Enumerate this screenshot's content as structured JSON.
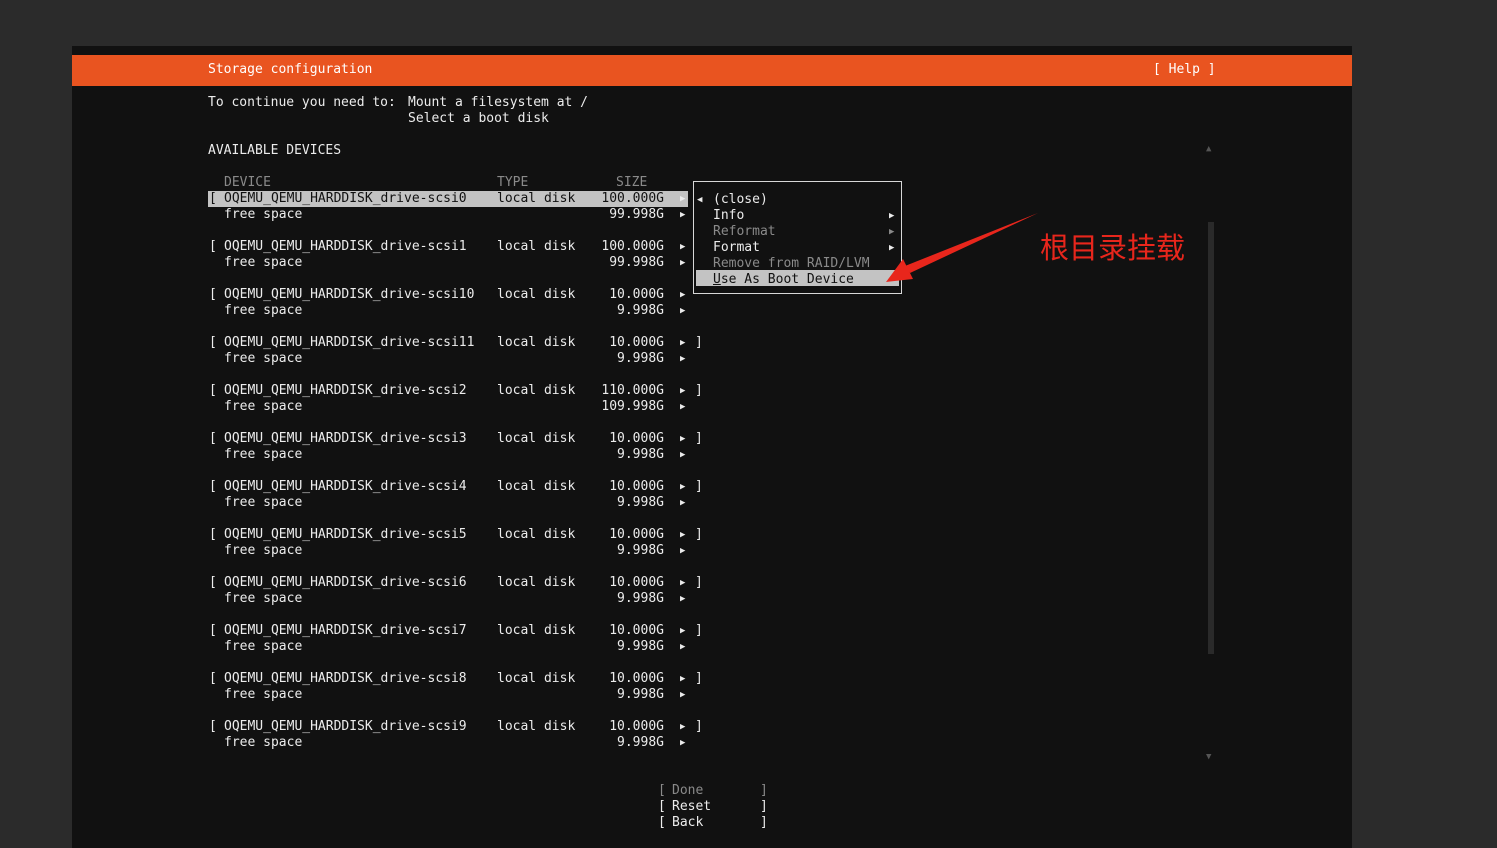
{
  "header": {
    "title": "Storage configuration",
    "help": "[ Help ]"
  },
  "intro": {
    "prefix": "To continue you need to:",
    "line1": "Mount a filesystem at /",
    "line2": "Select a boot disk"
  },
  "section_title": "AVAILABLE DEVICES",
  "columns": {
    "device": "DEVICE",
    "type": "TYPE",
    "size": "SIZE"
  },
  "devices": [
    {
      "name": "OQEMU_QEMU_HARDDISK_drive-scsi0",
      "type": "local disk",
      "size": "100.000G",
      "free_label": "free space",
      "free_size": "99.998G"
    },
    {
      "name": "OQEMU_QEMU_HARDDISK_drive-scsi1",
      "type": "local disk",
      "size": "100.000G",
      "free_label": "free space",
      "free_size": "99.998G"
    },
    {
      "name": "OQEMU_QEMU_HARDDISK_drive-scsi10",
      "type": "local disk",
      "size": "10.000G",
      "free_label": "free space",
      "free_size": "9.998G"
    },
    {
      "name": "OQEMU_QEMU_HARDDISK_drive-scsi11",
      "type": "local disk",
      "size": "10.000G",
      "free_label": "free space",
      "free_size": "9.998G"
    },
    {
      "name": "OQEMU_QEMU_HARDDISK_drive-scsi2",
      "type": "local disk",
      "size": "110.000G",
      "free_label": "free space",
      "free_size": "109.998G"
    },
    {
      "name": "OQEMU_QEMU_HARDDISK_drive-scsi3",
      "type": "local disk",
      "size": "10.000G",
      "free_label": "free space",
      "free_size": "9.998G"
    },
    {
      "name": "OQEMU_QEMU_HARDDISK_drive-scsi4",
      "type": "local disk",
      "size": "10.000G",
      "free_label": "free space",
      "free_size": "9.998G"
    },
    {
      "name": "OQEMU_QEMU_HARDDISK_drive-scsi5",
      "type": "local disk",
      "size": "10.000G",
      "free_label": "free space",
      "free_size": "9.998G"
    },
    {
      "name": "OQEMU_QEMU_HARDDISK_drive-scsi6",
      "type": "local disk",
      "size": "10.000G",
      "free_label": "free space",
      "free_size": "9.998G"
    },
    {
      "name": "OQEMU_QEMU_HARDDISK_drive-scsi7",
      "type": "local disk",
      "size": "10.000G",
      "free_label": "free space",
      "free_size": "9.998G"
    },
    {
      "name": "OQEMU_QEMU_HARDDISK_drive-scsi8",
      "type": "local disk",
      "size": "10.000G",
      "free_label": "free space",
      "free_size": "9.998G"
    },
    {
      "name": "OQEMU_QEMU_HARDDISK_drive-scsi9",
      "type": "local disk",
      "size": "10.000G",
      "free_label": "free space",
      "free_size": "9.998G"
    }
  ],
  "bracket_open": "[",
  "bracket_close": "]",
  "row_arrow": "▶",
  "menu": {
    "back_arrow": "◀",
    "items": [
      {
        "label": "(close)",
        "enabled": true
      },
      {
        "label": "Info",
        "enabled": true,
        "arrow": "▶"
      },
      {
        "label": "Reformat",
        "enabled": false,
        "arrow": "▶"
      },
      {
        "label": "Format",
        "enabled": true,
        "arrow": "▶"
      },
      {
        "label": "Remove from RAID/LVM",
        "enabled": false
      },
      {
        "first_letter": "U",
        "rest": "se As Boot Device",
        "enabled": true,
        "selected": true
      }
    ]
  },
  "buttons": [
    {
      "label": "Done",
      "enabled": false
    },
    {
      "label": "Reset",
      "enabled": true
    },
    {
      "label": "Back",
      "enabled": true
    }
  ],
  "scroll": {
    "up": "▲",
    "down": "▼"
  },
  "annotation": {
    "text": "根目录挂载",
    "color": "#e8261c"
  },
  "colors": {
    "accent": "#e95420",
    "background": "#111111",
    "selection": "#c3c3c3"
  }
}
